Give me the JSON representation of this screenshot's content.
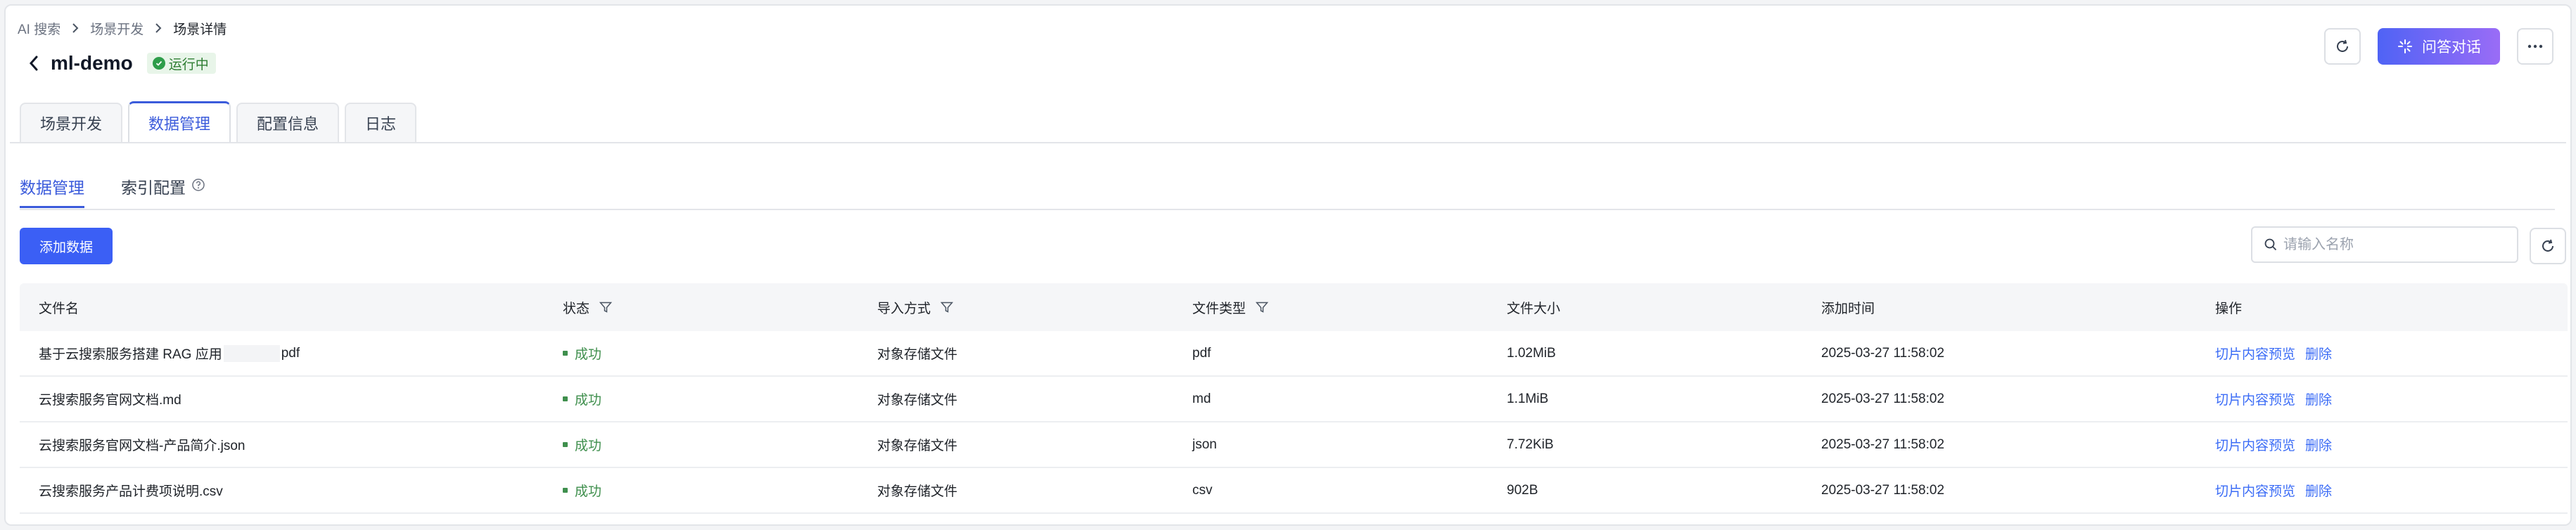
{
  "breadcrumb": [
    "AI 搜索",
    "场景开发",
    "场景详情"
  ],
  "header": {
    "title": "ml-demo",
    "status": "运行中",
    "qa_button": "问答对话"
  },
  "main_tabs": [
    "场景开发",
    "数据管理",
    "配置信息",
    "日志"
  ],
  "active_main_tab": "数据管理",
  "sub_tabs": [
    "数据管理",
    "索引配置"
  ],
  "active_sub_tab": "数据管理",
  "toolbar": {
    "add_button": "添加数据",
    "search_placeholder": "请输入名称"
  },
  "table": {
    "columns": [
      "文件名",
      "状态",
      "导入方式",
      "文件类型",
      "文件大小",
      "添加时间",
      "操作"
    ],
    "rows": [
      {
        "name_prefix": "基于云搜索服务搭建 RAG 应用",
        "name_suffix": "pdf",
        "status": "成功",
        "import": "对象存储文件",
        "type": "pdf",
        "size": "1.02MiB",
        "time": "2025-03-27 11:58:02"
      },
      {
        "name": "云搜索服务官网文档.md",
        "status": "成功",
        "import": "对象存储文件",
        "type": "md",
        "size": "1.1MiB",
        "time": "2025-03-27 11:58:02"
      },
      {
        "name": "云搜索服务官网文档-产品简介.json",
        "status": "成功",
        "import": "对象存储文件",
        "type": "json",
        "size": "7.72KiB",
        "time": "2025-03-27 11:58:02"
      },
      {
        "name": "云搜索服务产品计费项说明.csv",
        "status": "成功",
        "import": "对象存储文件",
        "type": "csv",
        "size": "902B",
        "time": "2025-03-27 11:58:02"
      }
    ],
    "actions": [
      "切片内容预览",
      "删除"
    ]
  },
  "colors": {
    "accent": "#3b5bdb",
    "primary_button": "#3b5ff5",
    "success": "#3f8f4d",
    "link": "#3b6cf6"
  }
}
